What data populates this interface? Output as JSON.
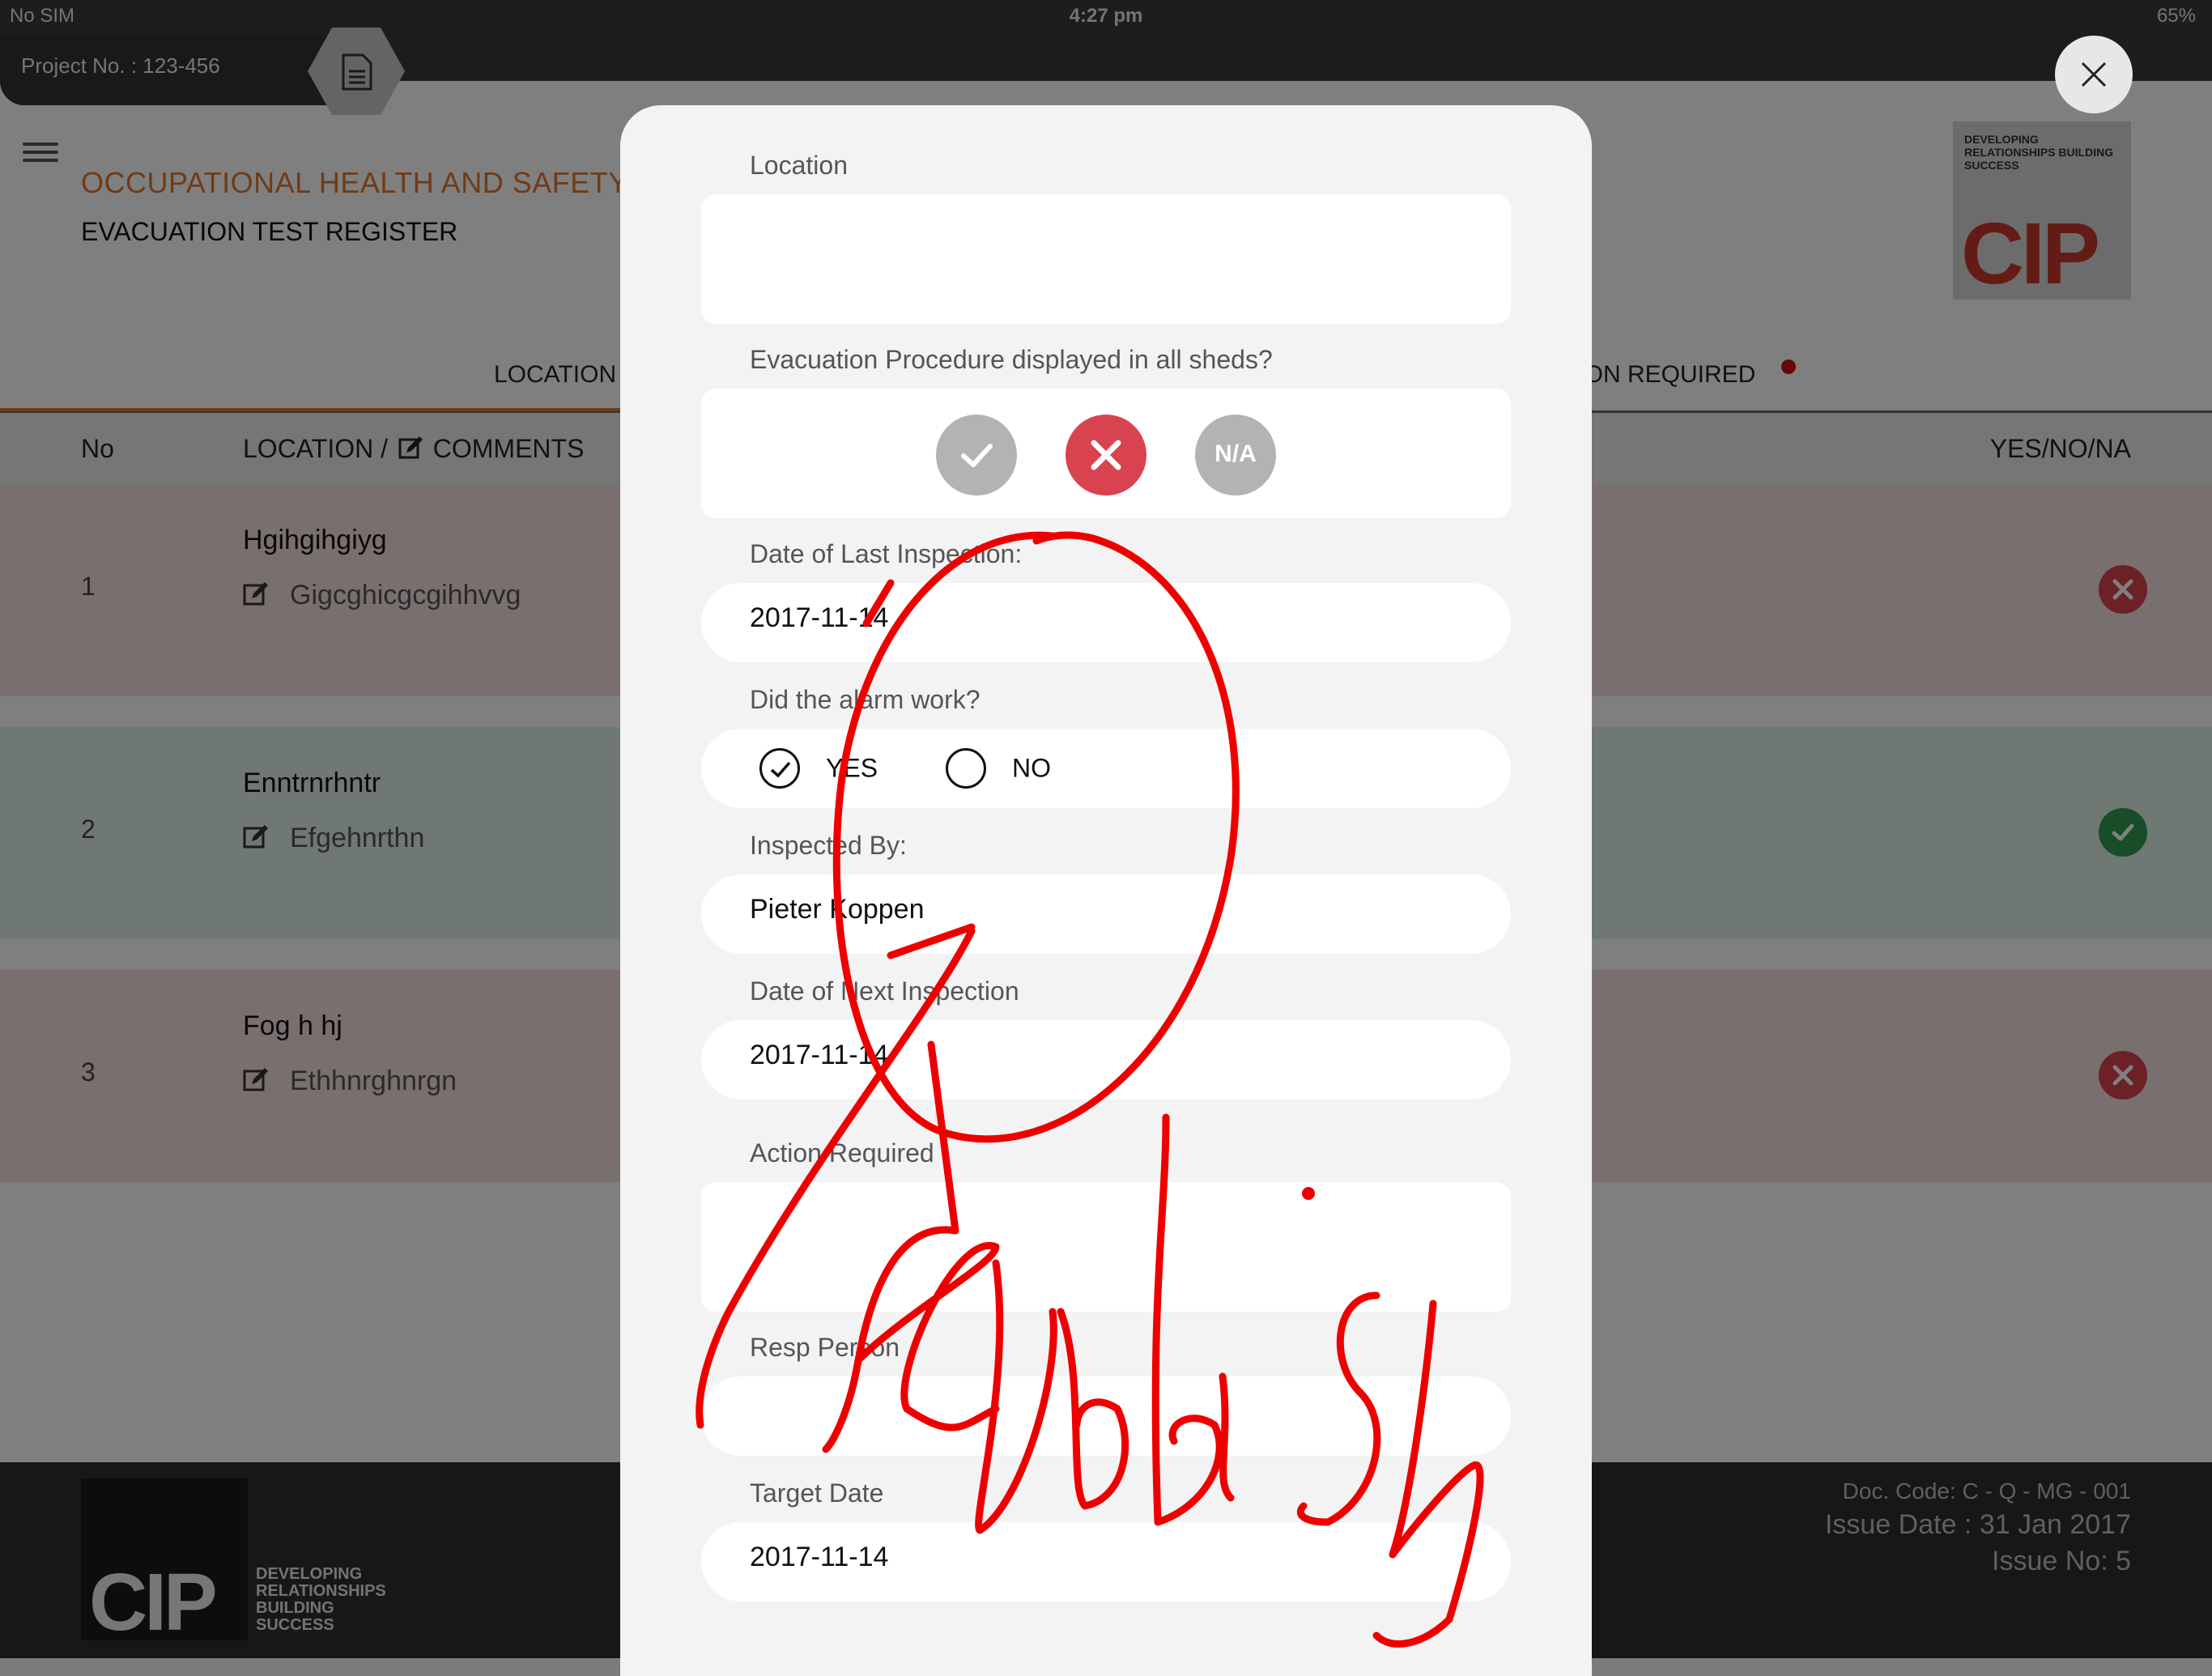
{
  "status_bar": {
    "carrier": "No SIM",
    "time": "4:27 pm",
    "battery": "65%"
  },
  "header": {
    "project": "Project No. : 123-456",
    "title": "OCCUPATIONAL HEALTH AND SAFETY",
    "subtitle": "EVACUATION TEST REGISTER",
    "logo_tagline": "DEVELOPING RELATIONSHIPS BUILDING SUCCESS",
    "logo_mark": "CIP"
  },
  "tabs": [
    {
      "label": "LOCATION"
    },
    {
      "label": "TION REQUIRED"
    }
  ],
  "table": {
    "columns": {
      "no": "No",
      "location": "LOCATION /",
      "comments": "COMMENTS",
      "yes_no_na": "YES/NO/NA"
    },
    "rows": [
      {
        "no": "1",
        "location": "Hgihgihgiyg",
        "comment": "Gigcghicgcgihhvvg",
        "status": "no",
        "color": "#f5dede"
      },
      {
        "no": "2",
        "location": "Enntrnrhntr",
        "comment": "Efgehnrthn",
        "status": "yes",
        "color": "#dff0e6"
      },
      {
        "no": "3",
        "location": "Fog h hj",
        "comment": "Ethhnrghnrgn",
        "status": "no",
        "color": "#f5dede"
      }
    ]
  },
  "footer": {
    "logo_mark": "CIP",
    "tagline": [
      "DEVELOPING",
      "RELATIONSHIPS",
      "BUILDING",
      "SUCCESS"
    ],
    "doc_code": "Doc. Code: C - Q - MG - 001",
    "issue_date": "Issue Date : 31 Jan 2017",
    "issue_no": "Issue No: 5"
  },
  "form": {
    "location_label": "Location",
    "location_value": "",
    "procedure_label": "Evacuation Procedure displayed in all sheds?",
    "procedure_options": {
      "na": "N/A"
    },
    "procedure_selected": "no",
    "last_inspection_label": "Date of Last Inspection:",
    "last_inspection_value": "2017-11-14",
    "alarm_label": "Did the alarm work?",
    "alarm_yes": "YES",
    "alarm_no": "NO",
    "alarm_selected": "yes",
    "inspected_by_label": "Inspected By:",
    "inspected_by_value": "Pieter Koppen",
    "next_inspection_label": "Date of Next Inspection",
    "next_inspection_value": "2017-11-14",
    "action_label": "Action Required",
    "action_value": "",
    "resp_person_label": "Resp Person",
    "resp_person_value": "",
    "target_date_label": "Target Date",
    "target_date_value": "2017-11-14"
  },
  "colors": {
    "accent_orange": "#e0772a",
    "status_red": "#d9434f",
    "status_green": "#2e9a52",
    "neutral_grey": "#b3b3b3",
    "scribble": "#ee0000"
  }
}
